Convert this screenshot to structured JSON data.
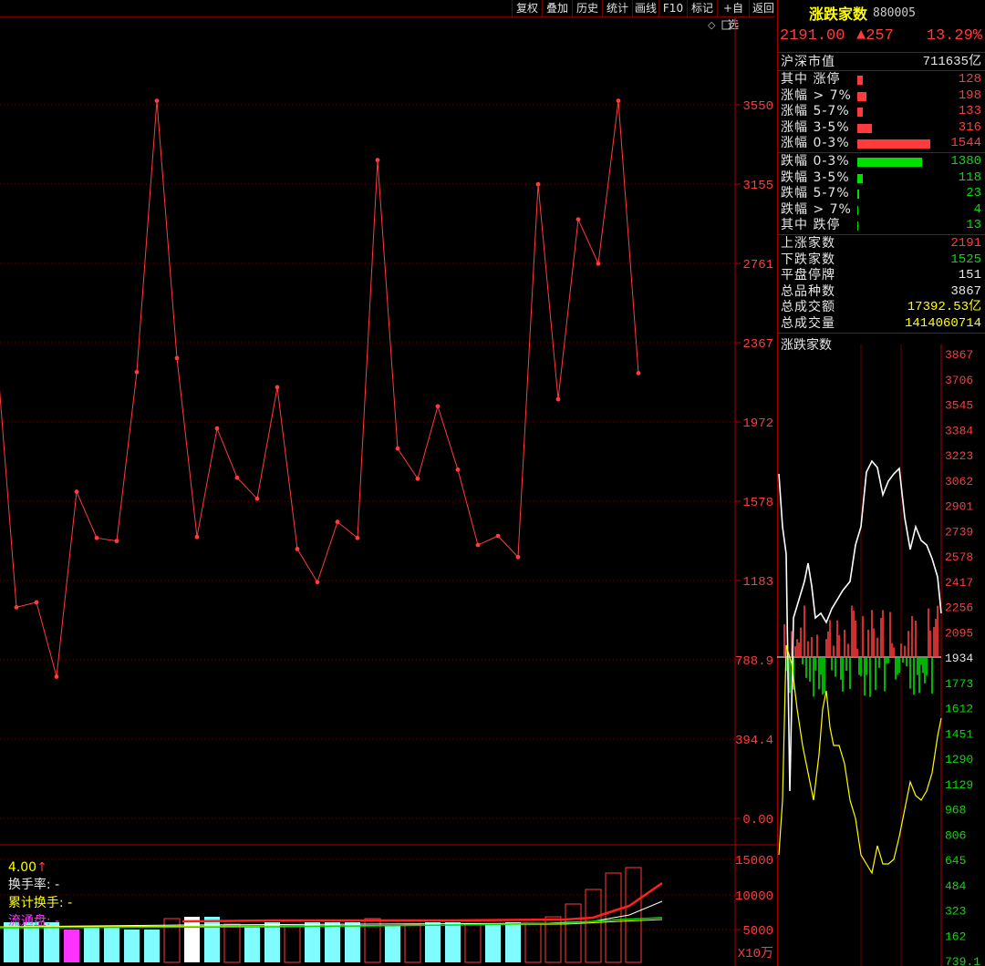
{
  "toolbar": {
    "buttons": [
      "复权",
      "叠加",
      "历史",
      "统计",
      "画线",
      "F10",
      "标记",
      "+自选",
      "返回"
    ]
  },
  "main_chart": {
    "y_ticks": [
      "3550",
      "3155",
      "2761",
      "2367",
      "1972",
      "1578",
      "1183",
      "788.9",
      "394.4",
      "0.00"
    ],
    "vol_ticks": [
      "15000",
      "10000",
      "5000",
      "X10万"
    ],
    "legend": {
      "prefix": "4.00",
      "arrow": "↑",
      "turnover_label": "换手率: -",
      "cum_turnover_label": "累计换手: -",
      "float_label": "流通盘: -"
    }
  },
  "chart_data": {
    "type": "line",
    "series": [
      {
        "values": [
          2340,
          1050,
          1075,
          705,
          1625,
          1395,
          1380,
          2220,
          3570,
          2290,
          1400,
          1940,
          1695,
          1590,
          2145,
          1340,
          1175,
          1475,
          1395,
          3275,
          1840,
          1690,
          2050,
          1735,
          1360,
          1405,
          1300,
          3155,
          2085,
          2980,
          2760,
          3570,
          2215
        ]
      }
    ],
    "ylim": [
      0,
      3900
    ]
  },
  "right_panel": {
    "title": "涨跌家数",
    "code": "880005",
    "price": "2191.00",
    "change": "▲257",
    "change_pct": "13.29%",
    "market_cap": {
      "label": "沪深市值",
      "value": "711635亿"
    },
    "up_stats": [
      {
        "label": "其中 涨停",
        "value": "128",
        "bar": 0.08
      },
      {
        "label": "涨幅 > 7%",
        "value": "198",
        "bar": 0.12
      },
      {
        "label": "涨幅 5-7%",
        "value": "133",
        "bar": 0.08
      },
      {
        "label": "涨幅 3-5%",
        "value": "316",
        "bar": 0.2
      },
      {
        "label": "涨幅 0-3%",
        "value": "1544",
        "bar": 1.0
      }
    ],
    "down_stats": [
      {
        "label": "跌幅 0-3%",
        "value": "1380",
        "bar": 0.89
      },
      {
        "label": "跌幅 3-5%",
        "value": "118",
        "bar": 0.07
      },
      {
        "label": "跌幅 5-7%",
        "value": "23",
        "bar": 0.02
      },
      {
        "label": "跌幅 > 7%",
        "value": "4",
        "bar": 0.01
      },
      {
        "label": "其中 跌停",
        "value": "13",
        "bar": 0.01
      }
    ],
    "summary": [
      {
        "label": "上涨家数",
        "value": "2191",
        "color": "#ff3b3b"
      },
      {
        "label": "下跌家数",
        "value": "1525",
        "color": "#00e000"
      },
      {
        "label": "平盘停牌",
        "value": "151",
        "color": "#e6e6e6"
      },
      {
        "label": "总品种数",
        "value": "3867",
        "color": "#e6e6e6"
      },
      {
        "label": "总成交额",
        "value": "17392.53亿",
        "color": "#ffff00"
      },
      {
        "label": "总成交量",
        "value": "1414060714",
        "color": "#ffff00"
      }
    ],
    "mini_chart": {
      "title": "涨跌家数",
      "ticks_up": [
        "3867",
        "3706",
        "3545",
        "3384",
        "3223",
        "3062",
        "2901",
        "2739",
        "2578",
        "2417",
        "2256",
        "2095"
      ],
      "tick_mid": "1934",
      "ticks_down": [
        "1773",
        "1612",
        "1451",
        "1290",
        "1129",
        "968",
        "806",
        "645",
        "484",
        "323",
        "162",
        "739.1"
      ]
    }
  },
  "colors": {
    "up": "#ff3b3b",
    "down": "#00e000",
    "grid": "#7a0000",
    "accent_yellow": "#ffff00",
    "magenta": "#ff33ff",
    "cyan": "#7ffcff"
  }
}
